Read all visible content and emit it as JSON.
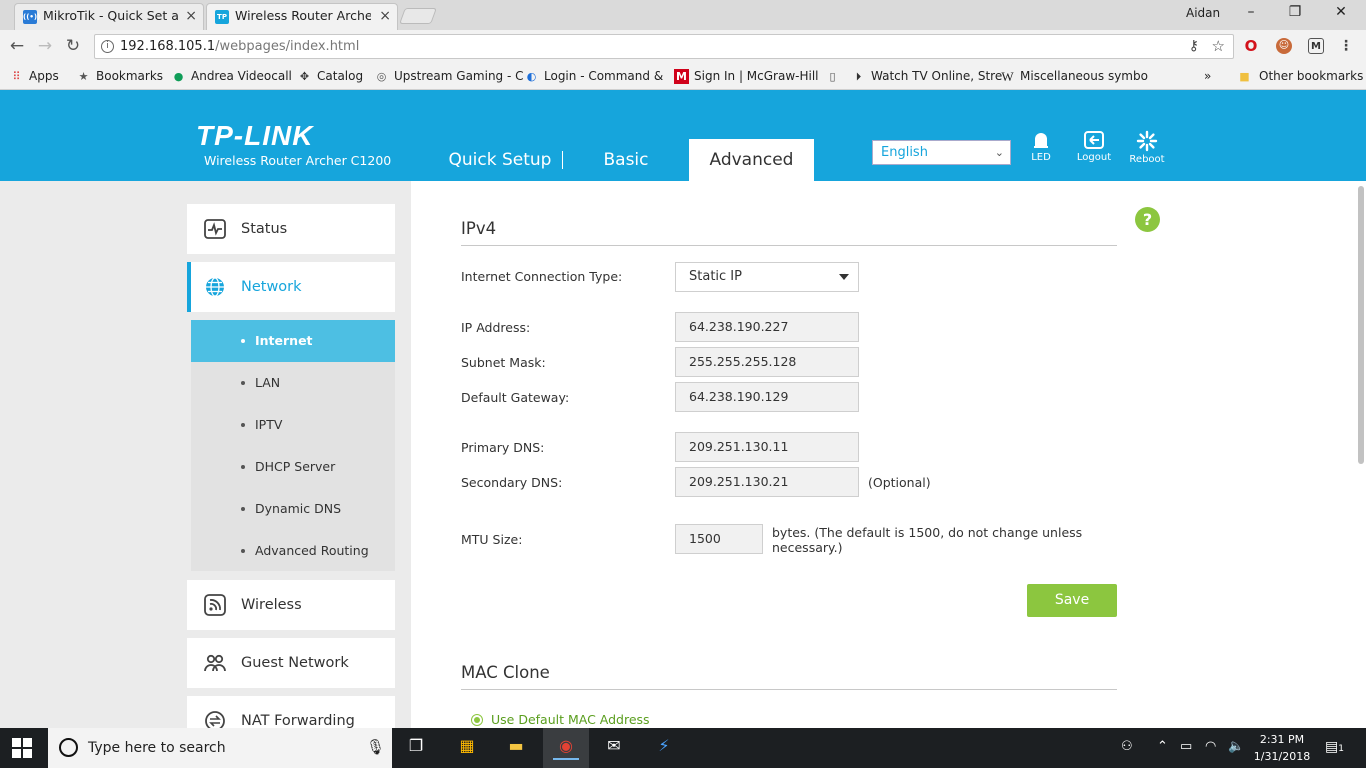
{
  "browser": {
    "tabs": [
      {
        "label": "MikroTik - Quick Set at a",
        "favicon": "mikrotik-icon"
      },
      {
        "label": "Wireless Router Archer C",
        "favicon": "tplink-icon"
      }
    ],
    "user": "Aidan",
    "url_host": "192.168.105.1",
    "url_path": "/webpages/index.html",
    "bookmarks": [
      {
        "label": "Apps",
        "icon": "apps-grid-icon"
      },
      {
        "label": "Bookmarks",
        "icon": "star-icon"
      },
      {
        "label": "Andrea Videocall",
        "icon": "hangouts-icon"
      },
      {
        "label": "Catalog",
        "icon": "catalog-icon"
      },
      {
        "label": "Upstream Gaming - C",
        "icon": "upstream-icon"
      },
      {
        "label": "Login - Command &",
        "icon": "login-icon"
      },
      {
        "label": "Sign In | McGraw-Hill",
        "icon": "mcgraw-icon"
      },
      {
        "label": "",
        "icon": "page-icon"
      },
      {
        "label": "Watch TV Online, Stre",
        "icon": "play-icon"
      },
      {
        "label": "Miscellaneous symbo",
        "icon": "wikipedia-icon"
      },
      {
        "label": "»",
        "icon": ""
      },
      {
        "label": "Other bookmarks",
        "icon": "folder-icon"
      }
    ]
  },
  "header": {
    "logo": "TP-LINK",
    "model": "Wireless Router Archer C1200",
    "nav": [
      "Quick Setup",
      "Basic",
      "Advanced"
    ],
    "language": "English",
    "icons": [
      {
        "label": "LED",
        "icon": "led-icon"
      },
      {
        "label": "Logout",
        "icon": "logout-icon"
      },
      {
        "label": "Reboot",
        "icon": "reboot-icon"
      }
    ]
  },
  "sidebar": {
    "items": [
      {
        "label": "Status",
        "icon": "status-icon"
      },
      {
        "label": "Network",
        "icon": "globe-icon"
      },
      {
        "label": "Wireless",
        "icon": "wireless-icon"
      },
      {
        "label": "Guest Network",
        "icon": "guest-icon"
      },
      {
        "label": "NAT Forwarding",
        "icon": "nat-icon"
      }
    ],
    "subitems": [
      "Internet",
      "LAN",
      "IPTV",
      "DHCP Server",
      "Dynamic DNS",
      "Advanced Routing"
    ]
  },
  "main": {
    "section1": "IPv4",
    "conn_type_label": "Internet Connection Type:",
    "conn_type_value": "Static IP",
    "fields": [
      {
        "label": "IP Address:",
        "value": "64.238.190.227"
      },
      {
        "label": "Subnet Mask:",
        "value": "255.255.255.128"
      },
      {
        "label": "Default Gateway:",
        "value": "64.238.190.129"
      },
      {
        "label": "Primary DNS:",
        "value": "209.251.130.11"
      },
      {
        "label": "Secondary DNS:",
        "value": "209.251.130.21"
      }
    ],
    "optional_note": "(Optional)",
    "mtu_label": "MTU Size:",
    "mtu_value": "1500",
    "mtu_note_1": "bytes. (The default is 1500, do not change unless",
    "mtu_note_2": "necessary.)",
    "save": "Save",
    "help": "?",
    "section2": "MAC Clone",
    "mac_option": "Use Default MAC Address"
  },
  "taskbar": {
    "search": "Type here to search",
    "time": "2:31 PM",
    "date": "1/31/2018",
    "notification_count": "1"
  }
}
